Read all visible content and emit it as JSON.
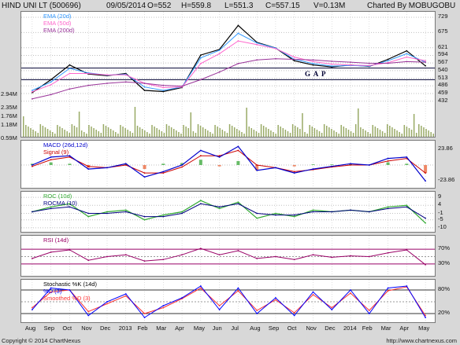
{
  "header": {
    "title": "HIND UNI LT (500696)",
    "date": "09/05/2014",
    "open": "O=552",
    "high": "H=559.8",
    "low": "L=551.3",
    "close": "C=557.15",
    "volume": "V=0.13M",
    "credit": "Charted By MOBUGOBU"
  },
  "footer": {
    "copyright": "Copyright © 2014 ChartNexus",
    "site": "http://www.chartnexus.com"
  },
  "colors": {
    "price": "#000000",
    "ema20": "#3399ff",
    "ema50": "#ff66cc",
    "ema200": "#993399",
    "macd": "#0000cc",
    "signal": "#cc0000",
    "roc": "#33aa33",
    "rocma": "#000080",
    "rsi": "#990066",
    "stk": "#0000ff",
    "std": "#ff3333",
    "volume": "#99aa66",
    "grid": "#c0c0c0"
  },
  "chart_data": [
    {
      "type": "line",
      "name": "price",
      "legend": [
        "EMA (20d)",
        "EMA (50d)",
        "EMA (200d)"
      ],
      "y_ticks": [
        "729",
        "675",
        "621",
        "594",
        "567",
        "540",
        "513",
        "486",
        "459",
        "432"
      ],
      "volume_ticks": [
        "2.94M",
        "2.35M",
        "1.76M",
        "1.18M",
        "0.59M"
      ],
      "annotation": "G A P",
      "gap_lines": [
        549,
        508
      ],
      "x": [
        "Aug",
        "Sep",
        "Oct",
        "Nov",
        "Dec",
        "2013",
        "Feb",
        "Mar",
        "Apr",
        "May",
        "Jun",
        "Jul",
        "Aug",
        "Sep",
        "Oct",
        "Nov",
        "Dec",
        "2014",
        "Feb",
        "Mar",
        "Apr",
        "May"
      ],
      "series": [
        {
          "name": "Price",
          "values": [
            462,
            508,
            560,
            528,
            522,
            530,
            470,
            466,
            480,
            595,
            615,
            700,
            640,
            620,
            575,
            560,
            553,
            560,
            555,
            580,
            610,
            557
          ]
        },
        {
          "name": "EMA (20d)",
          "values": [
            470,
            500,
            548,
            532,
            524,
            527,
            482,
            470,
            482,
            585,
            612,
            672,
            638,
            620,
            580,
            565,
            556,
            558,
            556,
            575,
            600,
            570
          ]
        },
        {
          "name": "EMA (50d)",
          "values": [
            465,
            490,
            530,
            530,
            525,
            525,
            495,
            480,
            482,
            565,
            600,
            645,
            632,
            618,
            588,
            572,
            563,
            560,
            558,
            568,
            588,
            575
          ]
        },
        {
          "name": "EMA (200d)",
          "values": [
            440,
            455,
            475,
            488,
            495,
            500,
            495,
            488,
            485,
            508,
            535,
            565,
            578,
            582,
            580,
            578,
            573,
            570,
            566,
            566,
            572,
            570
          ]
        }
      ]
    },
    {
      "type": "line",
      "name": "macd",
      "legend": [
        "MACD (26d,12d)",
        "Signal (9)"
      ],
      "y_ticks": [
        "23.86",
        "-23.86"
      ],
      "series": [
        {
          "name": "MACD (26d,12d)",
          "values": [
            0,
            12,
            14,
            -6,
            -4,
            2,
            -18,
            -10,
            0,
            22,
            12,
            28,
            -8,
            -4,
            -12,
            -6,
            -2,
            2,
            0,
            10,
            12,
            -24
          ]
        },
        {
          "name": "Signal (9)",
          "values": [
            -2,
            8,
            12,
            -2,
            -4,
            0,
            -12,
            -12,
            -3,
            14,
            14,
            22,
            0,
            -4,
            -10,
            -7,
            -3,
            0,
            0,
            6,
            10,
            -12
          ]
        }
      ]
    },
    {
      "type": "line",
      "name": "roc",
      "legend": [
        "ROC (10d)",
        "ROCMA (10)"
      ],
      "y_ticks": [
        "9",
        "4",
        "-1",
        "-5",
        "-10"
      ],
      "series": [
        {
          "name": "ROC (10d)",
          "values": [
            0,
            3,
            5,
            -3,
            0,
            1,
            -5,
            -2,
            0,
            7,
            2,
            6,
            -4,
            -1,
            -3,
            1,
            0,
            1,
            0,
            3,
            4,
            -7
          ]
        },
        {
          "name": "ROCMA (10)",
          "values": [
            0,
            2,
            3,
            -1,
            -1,
            0,
            -3,
            -3,
            -1,
            5,
            3,
            5,
            -1,
            -2,
            -2,
            0,
            0,
            1,
            0,
            2,
            3,
            -4
          ]
        }
      ]
    },
    {
      "type": "line",
      "name": "rsi",
      "legend": [
        "RSI (14d)"
      ],
      "y_ticks": [
        "70%",
        "30%"
      ],
      "levels": [
        70,
        50,
        30
      ],
      "series": [
        {
          "name": "RSI (14d)",
          "values": [
            45,
            62,
            68,
            40,
            50,
            55,
            38,
            42,
            55,
            72,
            55,
            66,
            45,
            50,
            42,
            55,
            48,
            52,
            50,
            60,
            68,
            28
          ]
        }
      ]
    },
    {
      "type": "line",
      "name": "stochastic",
      "legend": [
        "Stochastic %K (14d)",
        "%D (3)",
        "Smoothed %D (3)"
      ],
      "y_ticks": [
        "80%",
        "20%"
      ],
      "levels": [
        80,
        50,
        20
      ],
      "series": [
        {
          "name": "%K",
          "values": [
            30,
            85,
            80,
            15,
            50,
            70,
            10,
            40,
            60,
            90,
            30,
            85,
            20,
            60,
            15,
            75,
            30,
            80,
            20,
            85,
            90,
            10
          ]
        },
        {
          "name": "Smoothed %D",
          "values": [
            35,
            75,
            80,
            25,
            45,
            65,
            20,
            35,
            58,
            85,
            40,
            78,
            28,
            55,
            22,
            68,
            35,
            72,
            28,
            78,
            88,
            15
          ]
        }
      ]
    }
  ]
}
